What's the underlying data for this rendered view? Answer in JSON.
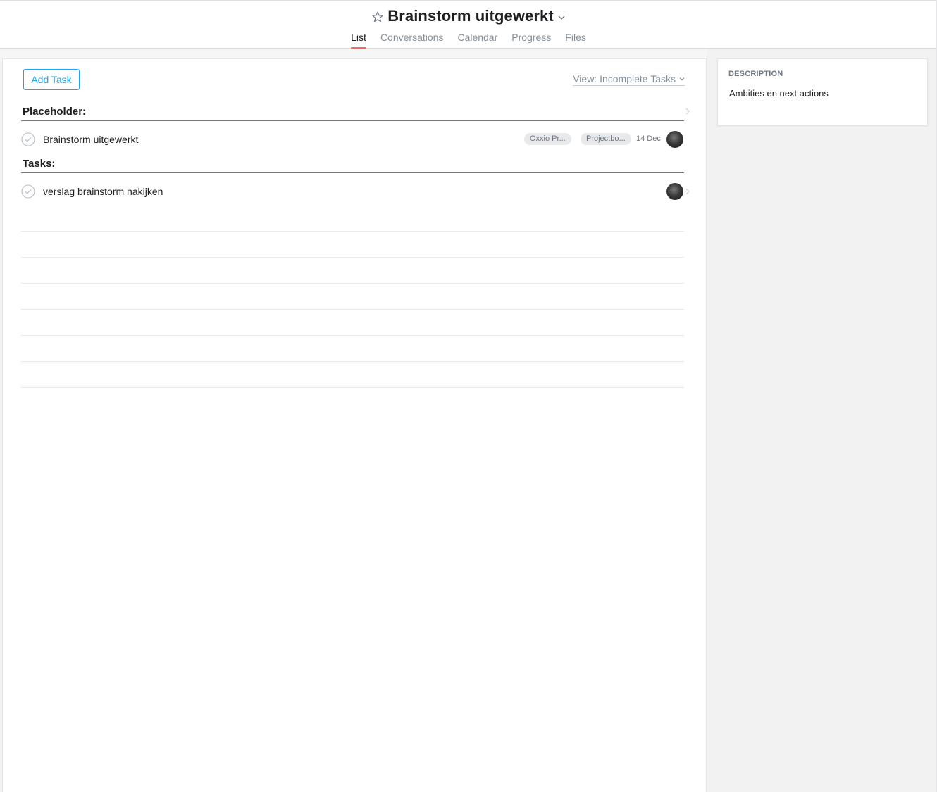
{
  "header": {
    "title": "Brainstorm uitgewerkt",
    "tabs": [
      {
        "label": "List",
        "active": true
      },
      {
        "label": "Conversations",
        "active": false
      },
      {
        "label": "Calendar",
        "active": false
      },
      {
        "label": "Progress",
        "active": false
      },
      {
        "label": "Files",
        "active": false
      }
    ],
    "icons": {
      "favorite": "star-icon",
      "menu": "chevron-down-icon"
    }
  },
  "toolbar": {
    "add_task_label": "Add Task",
    "view_label": "View: Incomplete Tasks"
  },
  "sections": [
    {
      "title": "Placeholder:",
      "tasks": [
        {
          "name": "Brainstorm uitgewerkt",
          "tags": [
            "Oxxio Pr...",
            "Projectbo..."
          ],
          "due": "14 Dec"
        }
      ]
    },
    {
      "title": "Tasks:",
      "tasks": [
        {
          "name": "verslag brainstorm nakijken",
          "tags": [],
          "due": ""
        }
      ]
    }
  ],
  "description": {
    "label": "DESCRIPTION",
    "text": "Ambities en next actions"
  },
  "colors": {
    "accent": "#14aaf5",
    "active_tab": "#f06a6a",
    "muted_text": "#848f99"
  }
}
